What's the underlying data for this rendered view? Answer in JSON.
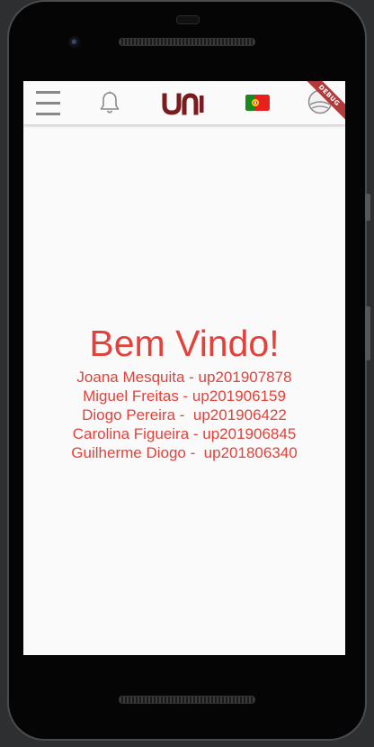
{
  "app": {
    "logo_text": "uni",
    "debug_label": "DEBUG"
  },
  "appbar": {
    "icons": [
      "menu-icon",
      "bell-icon",
      "uni-logo",
      "portugal-flag-icon",
      "profile-icon"
    ]
  },
  "main": {
    "welcome": "Bem Vindo!",
    "members": [
      "Joana Mesquita - up201907878",
      "Miguel Freitas - up201906159",
      "Diogo Pereira -  up201906422",
      "Carolina Figueira - up201906845",
      "Guilherme Diogo -  up201806340"
    ]
  },
  "colors": {
    "accent": "#e4413a",
    "logo": "#7a1c1e",
    "debug": "#b13a3d"
  }
}
